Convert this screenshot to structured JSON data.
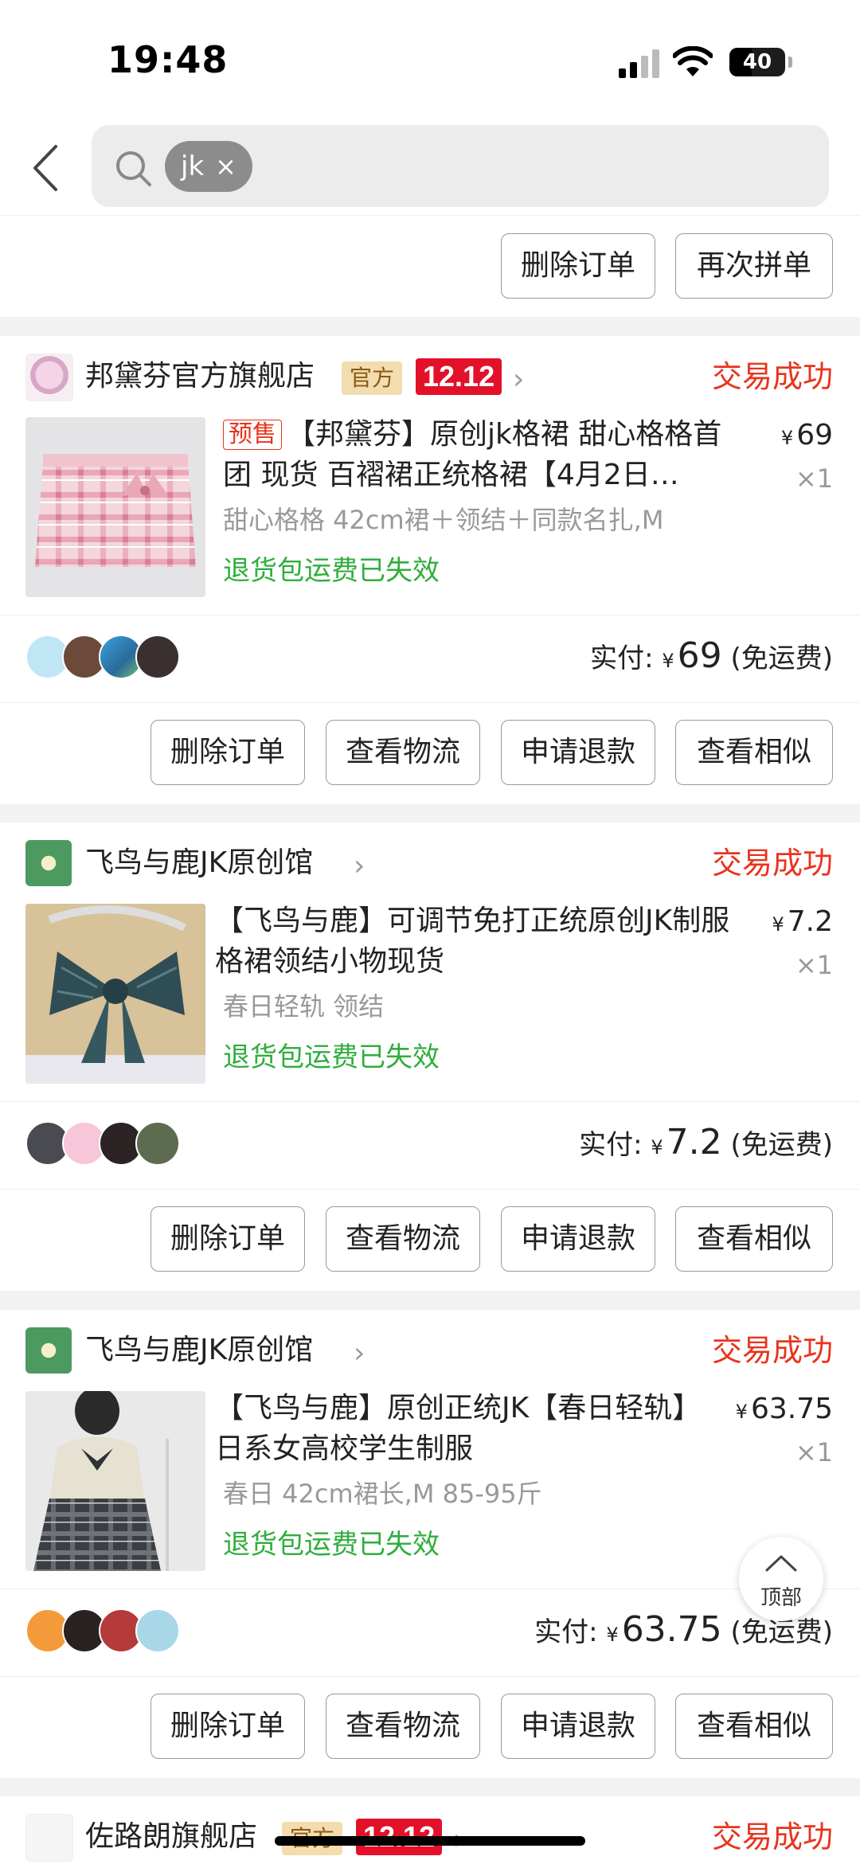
{
  "status_bar": {
    "time": "19:48",
    "battery": "40",
    "battery_level": 0.4
  },
  "search": {
    "chip": "jk",
    "chip_close": "×"
  },
  "top_card": {
    "buttons": [
      "删除订单",
      "再次拼单"
    ]
  },
  "orders": [
    {
      "shop": "邦黛芬官方旗舰店",
      "badge_official": "官方",
      "badge_1212": "12.12",
      "chevron": "›",
      "status": "交易成功",
      "presale": "预售",
      "title": "【邦黛芬】原创jk格裙 甜心格格首团 现货 百褶裙正统格裙【4月2日…",
      "price": "69",
      "currency": "¥",
      "qty": "×1",
      "spec": "甜心格格 42cm裙＋领结＋同款名扎,M",
      "refund": "退货包运费已失效",
      "paid_label": "实付:",
      "paid_amount": "69",
      "shipping": "(免运费)",
      "buttons": [
        "删除订单",
        "查看物流",
        "申请退款",
        "查看相似"
      ]
    },
    {
      "shop": "飞鸟与鹿JK原创馆",
      "chevron": "›",
      "status": "交易成功",
      "title": "【飞鸟与鹿】可调节免打正统原创JK制服格裙领结小物现货",
      "price": "7.2",
      "currency": "¥",
      "qty": "×1",
      "spec": "春日轻轨  领结",
      "refund": "退货包运费已失效",
      "paid_label": "实付:",
      "paid_amount": "7.2",
      "shipping": "(免运费)",
      "buttons": [
        "删除订单",
        "查看物流",
        "申请退款",
        "查看相似"
      ]
    },
    {
      "shop": "飞鸟与鹿JK原创馆",
      "chevron": "›",
      "status": "交易成功",
      "title": "【飞鸟与鹿】原创正统JK【春日轻轨】日系女高校学生制服",
      "price": "63.75",
      "currency": "¥",
      "qty": "×1",
      "spec": "春日 42cm裙长,M  85-95斤",
      "refund": "退货包运费已失效",
      "paid_label": "实付:",
      "paid_amount": "63.75",
      "shipping": "(免运费)",
      "buttons": [
        "删除订单",
        "查看物流",
        "申请退款",
        "查看相似"
      ]
    },
    {
      "shop": "佐路朗旗舰店",
      "badge_official": "官方",
      "badge_1212": "12.12",
      "chevron": "›",
      "status": "交易成功"
    }
  ],
  "back_to_top": "顶部",
  "colors": {
    "accent_red": "#e8341d",
    "refund_green": "#2fae3c",
    "badge_red": "#e3102a"
  }
}
